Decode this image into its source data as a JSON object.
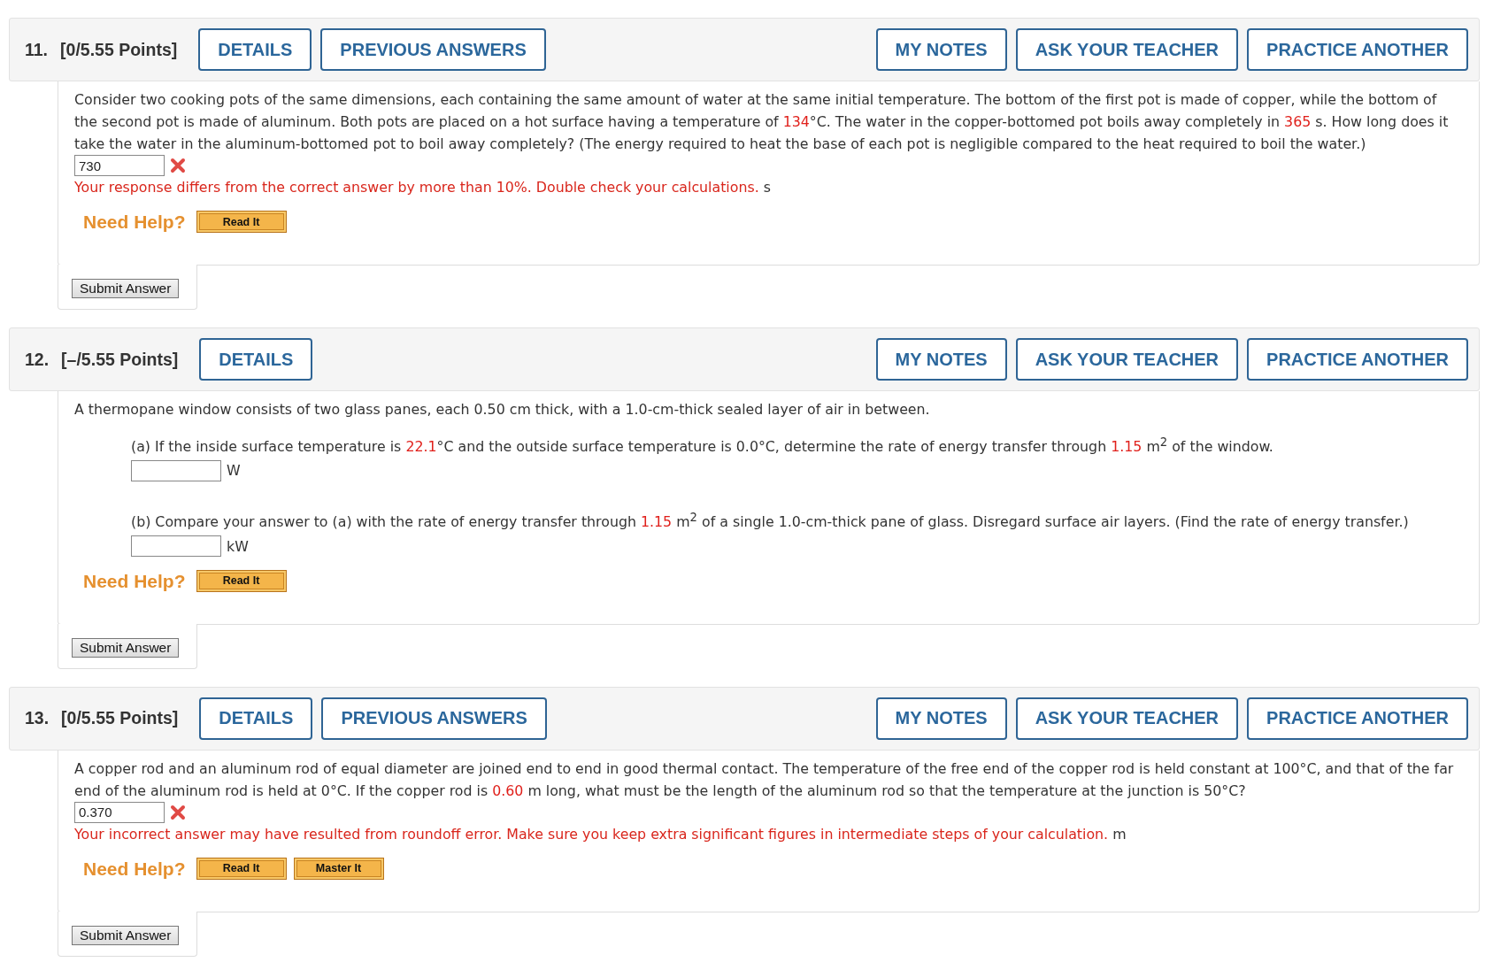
{
  "questions": [
    {
      "number": "11.",
      "points": "[0/5.55 Points]",
      "left_buttons": [
        "DETAILS",
        "PREVIOUS ANSWERS"
      ],
      "right_buttons": [
        "MY NOTES",
        "ASK YOUR TEACHER",
        "PRACTICE ANOTHER"
      ],
      "body": [
        {
          "kind": "prompt",
          "segments": [
            {
              "kind": "text",
              "text": "Consider two cooking pots of the same dimensions, each containing the same amount of water at the same initial temperature. The bottom of the first pot is made of copper, while the bottom of the second pot is made of aluminum. Both pots are placed on a hot surface having a temperature of "
            },
            {
              "kind": "value",
              "text": "134"
            },
            {
              "kind": "text",
              "text": "°C. The water in the copper-bottomed pot boils away completely in "
            },
            {
              "kind": "value",
              "text": "365"
            },
            {
              "kind": "text",
              "text": " s. How long does it take the water in the aluminum-bottomed pot to boil away completely? (The energy required to heat the base of each pot is negligible compared to the heat required to boil the water.)"
            }
          ]
        },
        {
          "kind": "answer",
          "value": "730",
          "correct": false
        },
        {
          "kind": "feedback",
          "message": "Your response differs from the correct answer by more than 10%. Double check your calculations.",
          "unit": "s"
        }
      ],
      "help": {
        "label": "Need Help?",
        "buttons": [
          "Read It"
        ]
      },
      "submit": "Submit Answer"
    },
    {
      "number": "12.",
      "points": "[–/5.55 Points]",
      "left_buttons": [
        "DETAILS"
      ],
      "right_buttons": [
        "MY NOTES",
        "ASK YOUR TEACHER",
        "PRACTICE ANOTHER"
      ],
      "body": [
        {
          "kind": "prompt",
          "segments": [
            {
              "kind": "text",
              "text": "A thermopane window consists of two glass panes, each 0.50 cm thick, with a 1.0-cm-thick sealed layer of air in between."
            }
          ]
        },
        {
          "kind": "subpart",
          "segments": [
            {
              "kind": "text",
              "text": "(a) If the inside surface temperature is "
            },
            {
              "kind": "value",
              "text": "22.1"
            },
            {
              "kind": "text",
              "text": "°C and the outside surface temperature is 0.0°C, determine the rate of energy transfer through "
            },
            {
              "kind": "value",
              "text": "1.15"
            },
            {
              "kind": "text",
              "text": " m$^{2}$ of the window."
            }
          ],
          "unit": "W"
        },
        {
          "kind": "subpart",
          "segments": [
            {
              "kind": "text",
              "text": "(b) Compare your answer to (a) with the rate of energy transfer through "
            },
            {
              "kind": "value",
              "text": "1.15"
            },
            {
              "kind": "text",
              "text": " m$^{2}$ of a single 1.0-cm-thick pane of glass. Disregard surface air layers. (Find the rate of energy transfer.)"
            }
          ],
          "unit": "kW"
        }
      ],
      "help": {
        "label": "Need Help?",
        "buttons": [
          "Read It"
        ]
      },
      "submit": "Submit Answer"
    },
    {
      "number": "13.",
      "points": "[0/5.55 Points]",
      "left_buttons": [
        "DETAILS",
        "PREVIOUS ANSWERS"
      ],
      "right_buttons": [
        "MY NOTES",
        "ASK YOUR TEACHER",
        "PRACTICE ANOTHER"
      ],
      "body": [
        {
          "kind": "prompt",
          "segments": [
            {
              "kind": "text",
              "text": "A copper rod and an aluminum rod of equal diameter are joined end to end in good thermal contact. The temperature of the free end of the copper rod is held constant at 100°C, and that of the far end of the aluminum rod is held at 0°C. If the copper rod is "
            },
            {
              "kind": "value",
              "text": "0.60"
            },
            {
              "kind": "text",
              "text": " m long, what must be the length of the aluminum rod so that the temperature at the junction is 50°C?"
            }
          ]
        },
        {
          "kind": "answer",
          "value": "0.370",
          "correct": false
        },
        {
          "kind": "feedback",
          "message": "Your incorrect answer may have resulted from roundoff error. Make sure you keep extra significant figures in intermediate steps of your calculation.",
          "unit": "m"
        }
      ],
      "help": {
        "label": "Need Help?",
        "buttons": [
          "Read It",
          "Master It"
        ]
      },
      "submit": "Submit Answer"
    }
  ]
}
